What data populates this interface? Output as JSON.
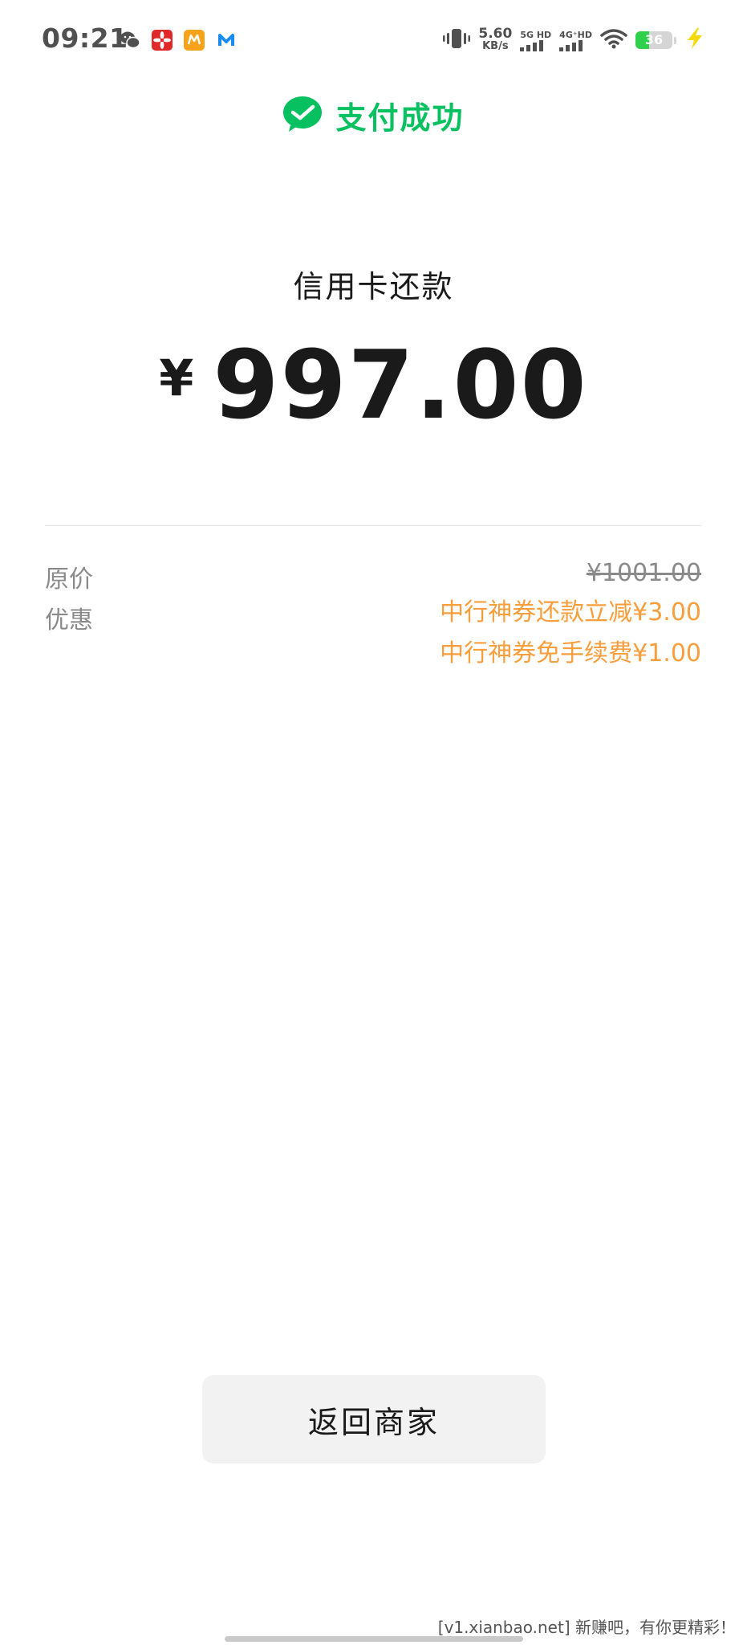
{
  "status_bar": {
    "time": "09:21",
    "net_speed_value": "5.60",
    "net_speed_unit": "KB/s",
    "sim1_label": "5G HD",
    "sim2_label": "4G⁺HD",
    "battery_level": "36",
    "battery_fraction": 0.36,
    "notification_icons": [
      "wechat-icon",
      "huawei-flower-icon",
      "yellow-app-icon",
      "blue-m-app-icon"
    ]
  },
  "header": {
    "title": "支付成功",
    "icon": "wechat-pay-icon",
    "accent_color": "#07c160"
  },
  "payment": {
    "merchant": "信用卡还款",
    "currency_symbol": "¥",
    "amount": "997.00"
  },
  "details": {
    "original_label": "原价",
    "original_price": "¥1001.00",
    "discount_label": "优惠",
    "discounts": [
      "中行神券还款立减¥3.00",
      "中行神券免手续费¥1.00"
    ],
    "discount_color": "#fa9d3b"
  },
  "actions": {
    "back_label": "返回商家"
  },
  "watermark": "[v1.xianbao.net] 新赚吧，有你更精彩！"
}
